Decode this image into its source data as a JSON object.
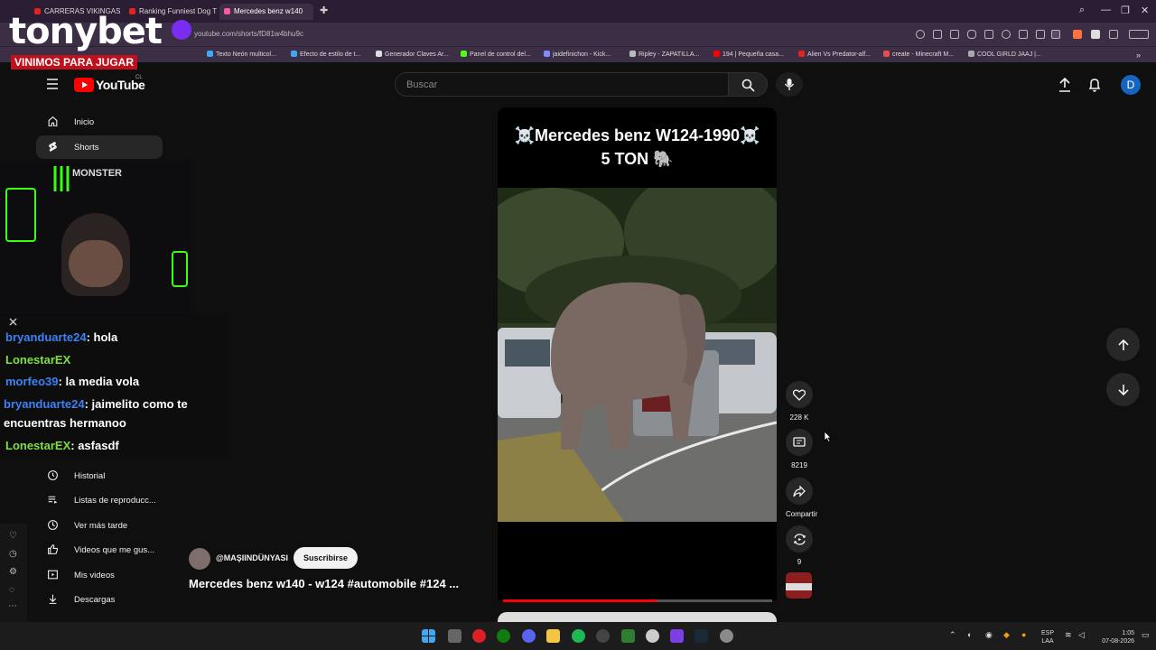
{
  "browser": {
    "tabs": [
      {
        "label": "CARRERAS VIKINGAS el m"
      },
      {
        "label": "Ranking Funniest Dog Tre"
      },
      {
        "label": "Mercedes benz w140"
      }
    ],
    "url": "youtube.com/shorts/fD81w4bhu9c",
    "bookmarks": [
      {
        "label": "Texto Neón multicol...",
        "color": "#3fa9f5"
      },
      {
        "label": "Efecto de estilo de t...",
        "color": "#3fa9f5"
      },
      {
        "label": "Generador Claves Ar...",
        "color": "#dddddd"
      },
      {
        "label": "Panel de control del...",
        "color": "#53fc18"
      },
      {
        "label": "jaidefinichon - Kick...",
        "color": "#7b8cff"
      },
      {
        "label": "Ripley - ZAPATILLA...",
        "color": "#bbbbbb"
      },
      {
        "label": "194 | Pequeña casa...",
        "color": "#ff0000"
      },
      {
        "label": "Alien Vs Predator-alf...",
        "color": "#e52222"
      },
      {
        "label": "create - Minecraft M...",
        "color": "#e84d4d"
      },
      {
        "label": "COOL GIRLD JAAJ |...",
        "color": "#aaaaaa"
      }
    ]
  },
  "youtube": {
    "logo_text": "YouTube",
    "country": "CL",
    "search_placeholder": "Buscar",
    "avatar_letter": "D",
    "sidebar": [
      {
        "label": "Inicio",
        "icon": "home-icon"
      },
      {
        "label": "Shorts",
        "icon": "shorts-icon"
      },
      {
        "label": "Historial",
        "icon": "history-icon"
      },
      {
        "label": "Listas de reproducc...",
        "icon": "playlist-icon"
      },
      {
        "label": "Ver más tarde",
        "icon": "clock-icon"
      },
      {
        "label": "Videos que me gus...",
        "icon": "thumbs-up-icon"
      },
      {
        "label": "Mis videos",
        "icon": "my-videos-icon"
      },
      {
        "label": "Descargas",
        "icon": "download-icon"
      }
    ],
    "short": {
      "title_line1": "☠️Mercedes benz W124-1990☠️",
      "title_line2": "5 TON 🐘",
      "progress": 0.57
    },
    "actions": {
      "likes": "228 K",
      "comments": "8219",
      "share": "Compartir",
      "remix": "9"
    },
    "channel": "@MAŞIINDÜNYASI",
    "subscribe": "Suscribirse",
    "video_title": "Mercedes benz w140 - w124 #automobile #124 ..."
  },
  "overlay": {
    "brand": "tonybet",
    "tagline": "VINIMOS PARA JUGAR",
    "sponsor": "MONSTER",
    "chat": [
      {
        "user": "bryanduarte24",
        "message": ": hola",
        "color": "#3b82f6"
      },
      {
        "user": "LonestarEX",
        "message": "",
        "color": "#7ee03c"
      },
      {
        "user": "morfeo39",
        "message": ": la media vola",
        "color": "#3b82f6"
      },
      {
        "user": "bryanduarte24",
        "message": ": jaimelito como te encuentras hermanoo",
        "color": "#3b82f6"
      },
      {
        "user": "LonestarEX",
        "message": ": asfasdf",
        "color": "#7ee03c"
      }
    ]
  },
  "taskbar": {
    "lang_top": "ESP",
    "lang_bottom": "LAA",
    "time": "1:05",
    "date": "07-08-2026"
  }
}
